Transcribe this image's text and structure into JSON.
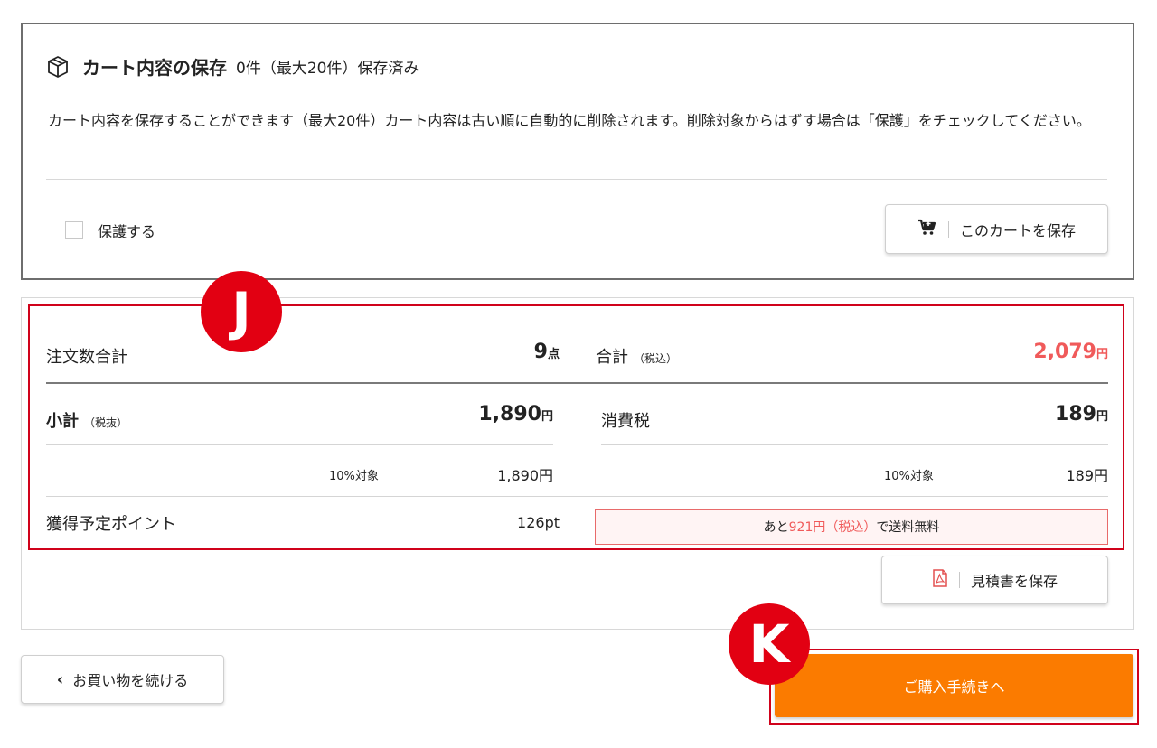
{
  "save_cart": {
    "title": "カート内容の保存",
    "status": "0件（最大20件）保存済み",
    "description": "カート内容を保存することができます（最大20件）カート内容は古い順に自動的に削除されます。削除対象からはずす場合は「保護」をチェックしてください。",
    "protect_label": "保護する",
    "save_button_label": "このカートを保存"
  },
  "summary": {
    "order_count_label": "注文数合計",
    "order_count_value": "9",
    "order_count_unit": "点",
    "total_label": "合計",
    "total_note": "（税込）",
    "total_value": "2,079",
    "total_unit": "円",
    "subtotal_label": "小計",
    "subtotal_note": "（税抜）",
    "subtotal_value": "1,890",
    "subtotal_unit": "円",
    "tax_label": "消費税",
    "tax_value": "189",
    "tax_unit": "円",
    "subtotal_breakdown_label": "10%対象",
    "subtotal_breakdown_value": "1,890円",
    "tax_breakdown_label": "10%対象",
    "tax_breakdown_value": "189円",
    "points_label": "獲得予定ポイント",
    "points_value": "126pt",
    "shipping_prefix": "あと",
    "shipping_amount": "921円（税込）",
    "shipping_suffix": "で送料無料"
  },
  "estimate_button_label": "見積書を保存",
  "continue_button_label": "お買い物を続ける",
  "checkout_button_label": "ご購入手続きへ",
  "annotations": {
    "badge_j": "J",
    "badge_k": "K"
  },
  "colors": {
    "accent_orange": "#fb7b00",
    "price_red": "#f05a5a",
    "annotation_red": "#e20012"
  },
  "icons": {
    "save_title": "box-icon",
    "save_button": "cart-icon",
    "estimate_button": "pdf-icon",
    "continue_button": "chevron-left-icon"
  }
}
